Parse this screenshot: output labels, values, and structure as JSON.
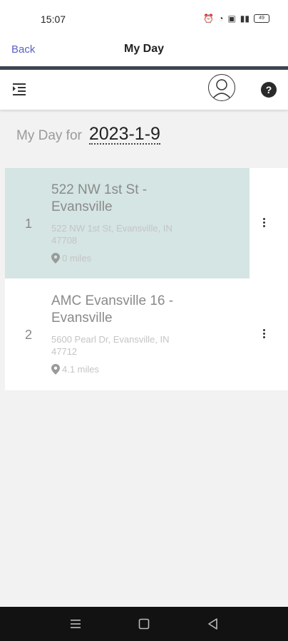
{
  "status_bar": {
    "time": "15:07",
    "icons": [
      "alarm-icon",
      "wifi-icon",
      "nfc-icon",
      "signal-icon",
      "battery-icon"
    ],
    "battery_label": "49"
  },
  "header": {
    "back_label": "Back",
    "title": "My Day"
  },
  "toolbar": {
    "icons": [
      "menu-indent-icon",
      "profile-icon",
      "help-icon"
    ],
    "help_glyph": "?"
  },
  "day": {
    "label": "My Day for",
    "date": "2023-1-9"
  },
  "stops": [
    {
      "number": "1",
      "name": "522 NW 1st St - Evansville",
      "address": "522 NW 1st St, Evansville, IN 47708",
      "distance": "0 miles",
      "selected": true
    },
    {
      "number": "2",
      "name": "AMC Evansville 16 - Evansville",
      "address": "5600 Pearl Dr, Evansville, IN 47712",
      "distance": "4.1 miles",
      "selected": false
    }
  ],
  "colors": {
    "accent": "#5a5fc8",
    "selected_row": "#d4e5e3",
    "header_rule": "#3d4550"
  }
}
